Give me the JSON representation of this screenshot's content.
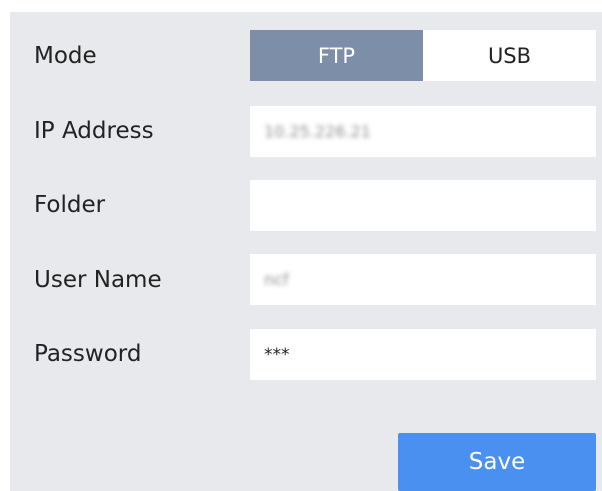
{
  "form": {
    "mode": {
      "label": "Mode",
      "options": [
        "FTP",
        "USB"
      ],
      "selected": "FTP"
    },
    "ip_address": {
      "label": "IP Address",
      "value": "10.25.226.21"
    },
    "folder": {
      "label": "Folder",
      "value": ""
    },
    "user_name": {
      "label": "User Name",
      "value": "ncf"
    },
    "password": {
      "label": "Password",
      "value": "***"
    },
    "save_label": "Save"
  },
  "colors": {
    "panel_bg": "#e8e9ec",
    "toggle_active": "#7d8ea8",
    "save_button": "#4a90f0"
  }
}
